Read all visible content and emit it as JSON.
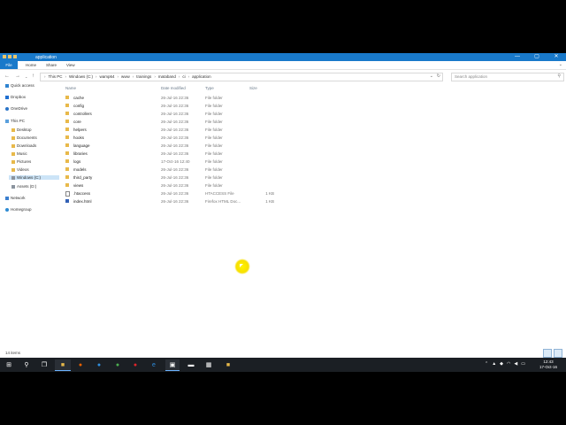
{
  "window": {
    "title": "application",
    "controls": [
      "—",
      "▢",
      "✕"
    ]
  },
  "ribbon": {
    "tabs": [
      "File",
      "Home",
      "Share",
      "View"
    ],
    "collapse": "⌄"
  },
  "address": {
    "crumbs": [
      "This PC",
      "Windows (C:)",
      "wamp64",
      "www",
      "trainings",
      "mataband",
      "ci",
      "application"
    ],
    "search_placeholder": "Search application"
  },
  "nav_pane": {
    "items": [
      {
        "label": "Quick access",
        "icon": "star-icon"
      },
      {
        "label": "Dropbox",
        "icon": "dropbox-icon"
      },
      {
        "label": "OneDrive",
        "icon": "onedrive-icon"
      },
      {
        "label": "This PC",
        "icon": "computer-icon"
      },
      {
        "label": "Desktop",
        "icon": "folder-icon"
      },
      {
        "label": "Documents",
        "icon": "folder-icon"
      },
      {
        "label": "Downloads",
        "icon": "folder-icon"
      },
      {
        "label": "Music",
        "icon": "folder-icon"
      },
      {
        "label": "Pictures",
        "icon": "folder-icon"
      },
      {
        "label": "Videos",
        "icon": "folder-icon"
      },
      {
        "label": "Windows (C:)",
        "icon": "drive-icon"
      },
      {
        "label": "Assets (D:)",
        "icon": "drive-icon"
      },
      {
        "label": "Network",
        "icon": "network-icon"
      },
      {
        "label": "Homegroup",
        "icon": "homegroup-icon"
      }
    ]
  },
  "columns": {
    "name": "Name",
    "date": "Date modified",
    "type": "Type",
    "size": "Size"
  },
  "files": [
    {
      "name": "cache",
      "date": "26-Jul-16 22:36",
      "type": "File folder",
      "size": "",
      "kind": "folder"
    },
    {
      "name": "config",
      "date": "26-Jul-16 22:36",
      "type": "File folder",
      "size": "",
      "kind": "folder"
    },
    {
      "name": "controllers",
      "date": "26-Jul-16 22:36",
      "type": "File folder",
      "size": "",
      "kind": "folder"
    },
    {
      "name": "core",
      "date": "26-Jul-16 22:36",
      "type": "File folder",
      "size": "",
      "kind": "folder"
    },
    {
      "name": "helpers",
      "date": "26-Jul-16 22:36",
      "type": "File folder",
      "size": "",
      "kind": "folder"
    },
    {
      "name": "hooks",
      "date": "26-Jul-16 22:36",
      "type": "File folder",
      "size": "",
      "kind": "folder"
    },
    {
      "name": "language",
      "date": "26-Jul-16 22:36",
      "type": "File folder",
      "size": "",
      "kind": "folder"
    },
    {
      "name": "libraries",
      "date": "26-Jul-16 22:36",
      "type": "File folder",
      "size": "",
      "kind": "folder"
    },
    {
      "name": "logs",
      "date": "17-Oct-16 12:40",
      "type": "File folder",
      "size": "",
      "kind": "folder"
    },
    {
      "name": "models",
      "date": "26-Jul-16 22:36",
      "type": "File folder",
      "size": "",
      "kind": "folder"
    },
    {
      "name": "third_party",
      "date": "26-Jul-16 22:36",
      "type": "File folder",
      "size": "",
      "kind": "folder"
    },
    {
      "name": "views",
      "date": "26-Jul-16 22:36",
      "type": "File folder",
      "size": "",
      "kind": "folder"
    },
    {
      "name": ".htaccess",
      "date": "26-Jul-16 22:36",
      "type": "HTACCESS File",
      "size": "1 KB",
      "kind": "file"
    },
    {
      "name": "index.html",
      "date": "26-Jul-16 22:36",
      "type": "Firefox HTML Doc...",
      "size": "1 KB",
      "kind": "html"
    }
  ],
  "status": {
    "count": "14 items"
  },
  "taskbar": {
    "time": "12:43",
    "date": "17-Oct-16"
  },
  "colors": {
    "accent": "#1979ca",
    "taskbar": "#1b1f24",
    "folder": "#e8b94a"
  }
}
